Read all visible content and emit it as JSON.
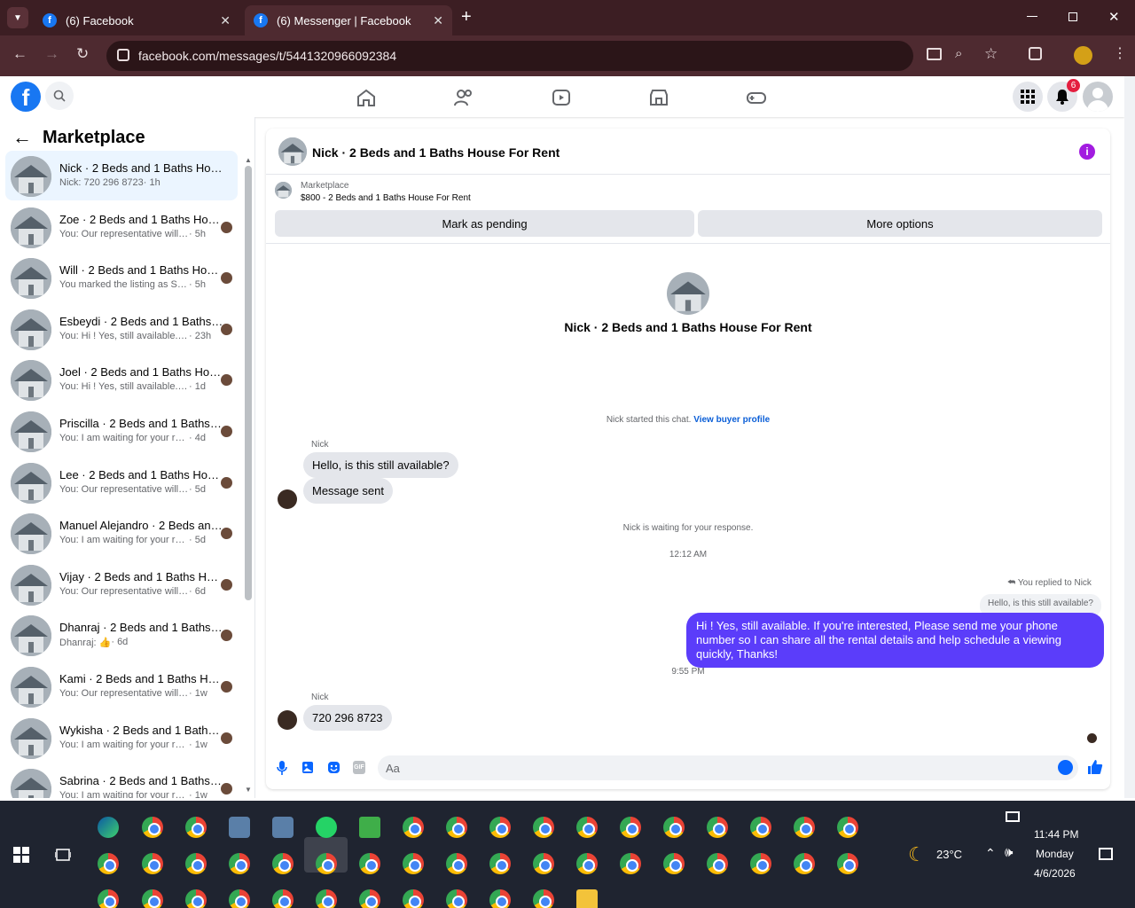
{
  "browser": {
    "tabs": [
      {
        "label": "(6) Facebook"
      },
      {
        "label": "(6) Messenger | Facebook"
      }
    ],
    "url": "facebook.com/messages/t/5441320966092384"
  },
  "fb": {
    "notif_count": "6"
  },
  "sidebar": {
    "title": "Marketplace",
    "items": [
      {
        "name": "Nick · 2 Beds and 1 Baths House For Rent",
        "preview": "Nick: 720 296 8723",
        "time": " · 1h"
      },
      {
        "name": "Zoe · 2 Beds and 1 Baths House For Rent",
        "preview": "You: Our representative will contact you",
        "time": " · 5h"
      },
      {
        "name": "Will · 2 Beds and 1 Baths House For Rent",
        "preview": "You marked the listing as Sold.",
        "time": " · 5h"
      },
      {
        "name": "Esbeydi · 2 Beds and 1 Baths House For Rent",
        "preview": "You: Hi ! Yes, still available. If you're",
        "time": " · 23h"
      },
      {
        "name": "Joel · 2 Beds and 1 Baths House For Rent",
        "preview": "You: Hi ! Yes, still available. If you're",
        "time": " · 1d"
      },
      {
        "name": "Priscilla · 2 Beds and 1 Baths House For Rent",
        "preview": "You: I am waiting for your reply,",
        "time": " · 4d"
      },
      {
        "name": "Lee · 2 Beds and 1 Baths House For Rent",
        "preview": "You: Our representative will contact you",
        "time": " · 5d"
      },
      {
        "name": "Manuel Alejandro · 2 Beds and 1 Baths House",
        "preview": "You: I am waiting for your reply,",
        "time": " · 5d"
      },
      {
        "name": "Vijay · 2 Beds and 1 Baths House For Rent",
        "preview": "You: Our representative will contact you",
        "time": " · 6d"
      },
      {
        "name": "Dhanraj · 2 Beds and 1 Baths House For Rent",
        "preview": "Dhanraj: 👍",
        "time": " · 6d"
      },
      {
        "name": "Kami · 2 Beds and 1 Baths House For Rent",
        "preview": "You: Our representative will contact you",
        "time": " · 1w"
      },
      {
        "name": "Wykisha · 2 Beds and 1 Baths House For Rent",
        "preview": "You: I am waiting for your reply,",
        "time": " · 1w"
      },
      {
        "name": "Sabrina · 2 Beds and 1 Baths House For Rent",
        "preview": "You: I am waiting for your reply,",
        "time": " · 1w"
      }
    ]
  },
  "chat": {
    "title": "Nick · 2 Beds and 1 Baths House For Rent",
    "marketplace_label": "Marketplace",
    "listing": "$800 - 2 Beds and 1 Baths House For Rent",
    "mark_pending": "Mark as pending",
    "more_options": "More options",
    "profile_name": "Nick · 2 Beds and 1 Baths House For Rent",
    "started": "Nick started this chat.",
    "view_buyer": "View buyer profile",
    "sender1": "Nick",
    "msg1": "Hello, is this still available?",
    "msg2": "Message sent",
    "waiting": "Nick is waiting for your response.",
    "time1": "12:12 AM",
    "replied_to": "You replied to Nick",
    "quoted": "Hello, is this still available?",
    "my_msg": "Hi ! Yes, still available. If you're interested, Please send me your phone number so I can share all the rental details and help schedule a viewing quickly, Thanks!",
    "time2": "9:55 PM",
    "sender2": "Nick",
    "msg3": "720 296 8723",
    "input_placeholder": "Aa"
  },
  "taskbar": {
    "time": "11:44 PM",
    "day": "Monday",
    "date": "4/6/2026",
    "temp": "23°C"
  }
}
